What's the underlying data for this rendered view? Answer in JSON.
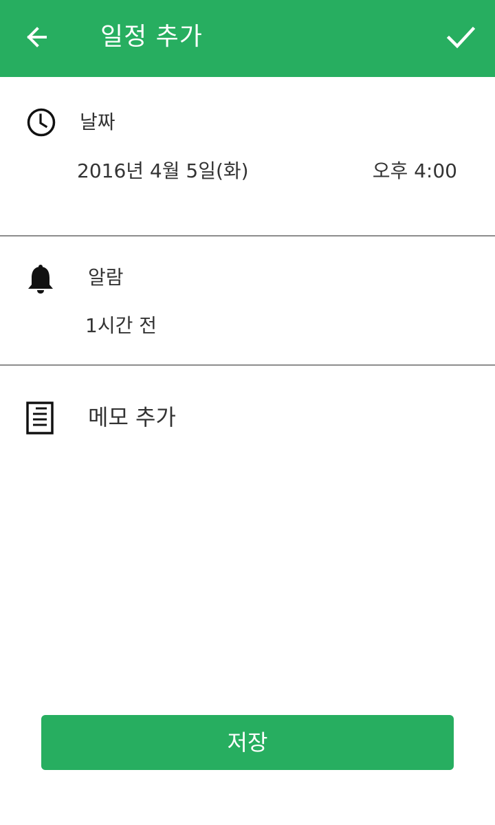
{
  "header": {
    "title": "일정 추가",
    "back_icon": "arrow-left-icon",
    "confirm_icon": "check-icon"
  },
  "date_section": {
    "icon": "clock-icon",
    "label": "날짜",
    "date": "2016년 4월 5일(화)",
    "time": "오후 4:00"
  },
  "alarm_section": {
    "icon": "bell-icon",
    "label": "알람",
    "value": "1시간 전"
  },
  "memo_section": {
    "icon": "document-icon",
    "label": "메모 추가"
  },
  "save_button": {
    "label": "저장"
  },
  "colors": {
    "accent": "#27ae60",
    "text": "#333333",
    "divider": "#8c8c8c"
  }
}
